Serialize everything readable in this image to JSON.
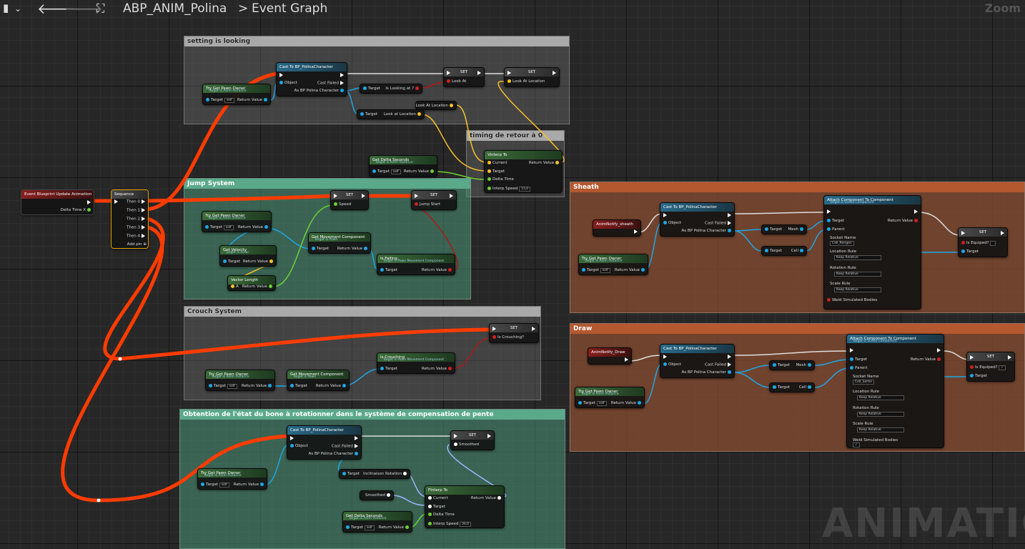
{
  "topbar": {
    "asset": "ABP_ANIM_Polina",
    "separator": ">",
    "graph": "Event Graph",
    "zoom": "Zoom"
  },
  "watermark": "ANIMATION",
  "comments": {
    "looking": "setting is looking",
    "timing": "timing de retour à 0",
    "jump": "Jump System",
    "crouch": "Crouch System",
    "bone": "Obtention de l'état du bone à rotationner dans le système de compensation de pente",
    "sheath": "Sheath",
    "draw": "Draw"
  },
  "labels": {
    "cast": "Cast To BP_PolinaCharacter",
    "object": "Object",
    "cast_failed": "Cast Failed",
    "as_bp": "As BP Polina Character",
    "try_get": "Try Get Pawn Owner",
    "target_anim": "Target is Anim Instance",
    "target": "Target",
    "self": "self",
    "return_value": "Return Value",
    "set": "SET",
    "look_at": "Look At",
    "look_at_loc": "Look At Location",
    "is_looking": "Is Looking at ?",
    "look_at_location": "Look at Location",
    "finterp": "FInterp To",
    "vinterp": "Vinterp To",
    "current": "Current",
    "delta_time": "Delta Time",
    "interp_speed": "Interp Speed",
    "speed_15": "15,0",
    "speed_20": "20,0",
    "get_delta": "Get Delta Seconds",
    "event_update": "Event Blueprint Update Animation",
    "delta_time_x": "Delta Time X",
    "sequence": "Sequence",
    "then0": "Then 0",
    "then1": "Then 1",
    "then2": "Then 2",
    "then3": "Then 3",
    "then4": "Then 4",
    "add_pin": "Add pin",
    "speed": "Speed",
    "jump_start": "Jump Start",
    "get_move_comp": "Get Movement Component",
    "target_pawn": "Target is Pawn",
    "get_velocity": "Get Velocity",
    "target_actor": "Target is Actor",
    "vector_length": "Vector Length",
    "a": "A",
    "is_falling": "Is Falling",
    "target_pawn_move": "Target is Pawn Movement Component",
    "is_crouching_q": "Is Crouching?",
    "is_crouching": "Is Crouching",
    "smoothed": "Smoothed",
    "inclinaison": "Inclinaison Rotation",
    "anim_sheath": "AnimNotify_sheath",
    "anim_draw": "AnimNotify_Draw",
    "mesh": "Mesh",
    "cell": "Cell",
    "attach": "Attach Component To Component",
    "target_scene": "Target is Scene Component",
    "parent": "Parent",
    "socket_name": "Socket Name",
    "socket_sheath": "Cell_Rengen",
    "socket_draw": "Cell_Sortie",
    "location_rule": "Location Rule",
    "rotation_rule": "Rotation Rule",
    "scale_rule": "Scale Rule",
    "keep_relative": "Keep Relative",
    "weld": "Weld Simulated Bodies",
    "is_equiped": "Is Equiped?"
  },
  "colors": {
    "exec": "#ffffff",
    "object": "#1fa7e6",
    "float": "#6cd036",
    "bool": "#d02020",
    "vector": "#f7c22a",
    "main_wire": "#ff3c00"
  }
}
